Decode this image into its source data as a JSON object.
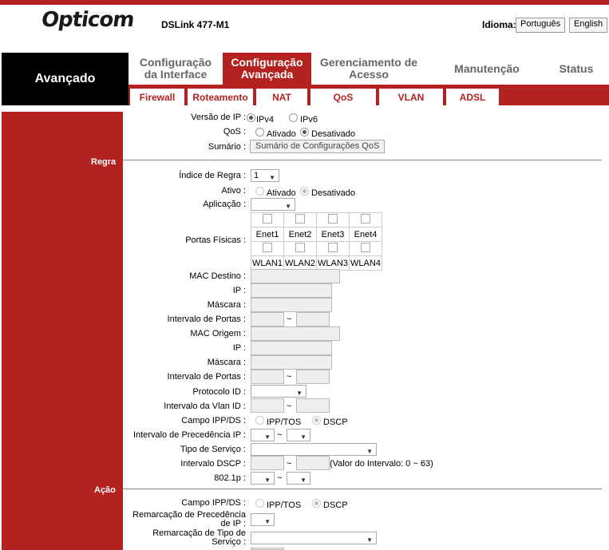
{
  "header": {
    "brand": "Opticom",
    "brand_sub": "___________",
    "model": "DSLink 477-M1",
    "idioma_label": "Idioma:",
    "lang_pt": "Português",
    "lang_en": "English"
  },
  "section_title": "Avançado",
  "main_tabs": {
    "config_interface": "Configuração da Interface",
    "config_avancada": "Configuração Avançada",
    "gerenciamento": "Gerenciamento de Acesso",
    "manutencao": "Manutenção",
    "status": "Status"
  },
  "sub_tabs": {
    "firewall": "Firewall",
    "roteamento": "Roteamento",
    "nat": "NAT",
    "qos": "QoS",
    "vlan": "VLAN",
    "adsl": "ADSL"
  },
  "top": {
    "versao_ip": "Versão de IP :",
    "ipv4": "IPv4",
    "ipv6": "IPv6",
    "qos": "QoS :",
    "ativado": "Ativado",
    "desativado": "Desativado",
    "sumario": "Sumário :",
    "sumario_btn": "Sumário de Configurações QoS"
  },
  "regra": {
    "title": "Regra",
    "indice": "Índice de Regra :",
    "indice_val": "1",
    "ativo": "Ativo :",
    "ativado": "Ativado",
    "desativado": "Desativado",
    "aplicacao": "Aplicação :",
    "portas": "Portas Físicas :",
    "enet": [
      "Enet1",
      "Enet2",
      "Enet3",
      "Enet4"
    ],
    "wlan": [
      "WLAN1",
      "WLAN2",
      "WLAN3",
      "WLAN4"
    ],
    "mac_destino": "MAC Destino :",
    "ip1": "IP :",
    "mascara1": "Máscara :",
    "int_portas1": "Intervalo de Portas :",
    "mac_origem": "MAC Origem :",
    "ip2": "IP :",
    "mascara2": "Máscara :",
    "int_portas2": "Intervalo de Portas :",
    "protocolo": "Protocolo ID :",
    "vlan_id": "Intervalo da Vlan ID :",
    "campo_ipp": "Campo IPP/DS :",
    "ipp_tos": "IPP/TOS",
    "dscp": "DSCP",
    "int_prec": "Intervalo de Precedência IP :",
    "tipo_servico": "Tipo de Serviço :",
    "int_dscp": "Intervalo DSCP :",
    "dscp_note": "(Valor do Intervalo: 0 ~ 63)",
    "p8021": "802.1p :",
    "tilde": "~"
  },
  "acao": {
    "title": "Ação",
    "campo_ipp": "Campo IPP/DS :",
    "ipp_tos": "IPP/TOS",
    "dscp": "DSCP",
    "remarc_prec_1": "Remarcação de Precedência",
    "remarc_prec_2": "de IP :",
    "remarc_tipo_1": "Remarcação de Tipo de",
    "remarc_tipo_2": "Serviço :"
  },
  "colors": {
    "accent": "#b3221f",
    "field_bg": "#eeeeec"
  }
}
